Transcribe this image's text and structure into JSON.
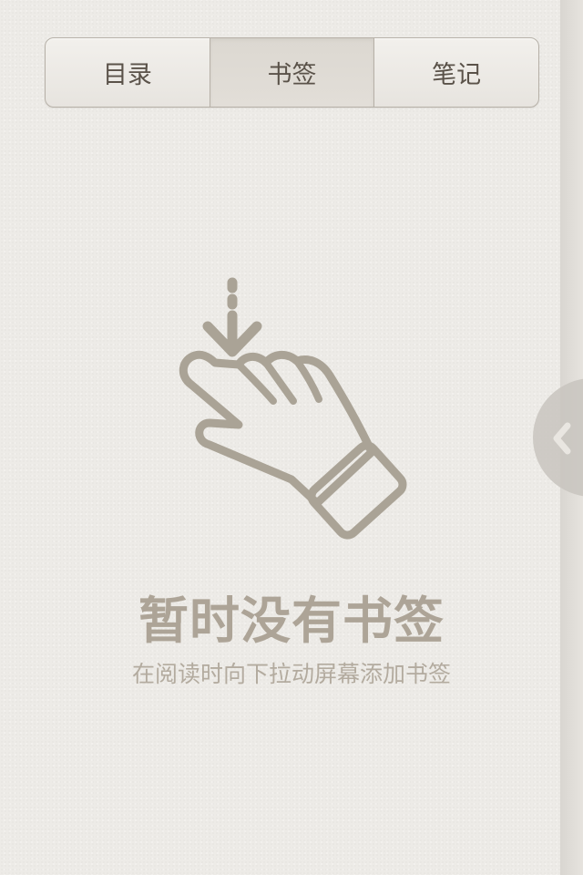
{
  "tabs": [
    {
      "label": "目录"
    },
    {
      "label": "书签"
    },
    {
      "label": "笔记"
    }
  ],
  "active_tab": "书签",
  "empty_state": {
    "title": "暂时没有书签",
    "subtitle": "在阅读时向下拉动屏幕添加书签",
    "icon": "pull-down-hand-icon"
  },
  "drawer_handle_icon": "chevron-left-icon",
  "colors": {
    "background": "#edebe7",
    "icon": "#aaa396",
    "title": "#ada497",
    "tab_text": "#5a5249",
    "tab_border": "#b6b0a7"
  }
}
